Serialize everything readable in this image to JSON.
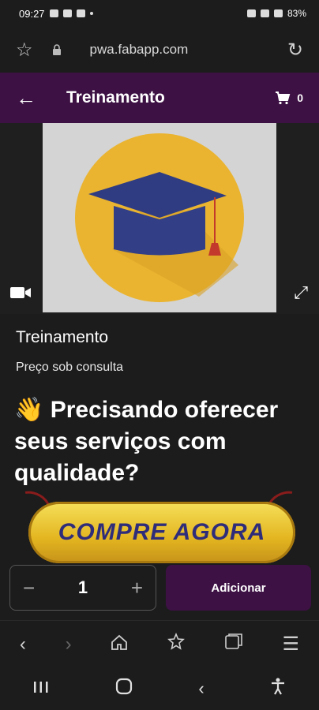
{
  "status": {
    "time": "09:27",
    "battery": "83%"
  },
  "browser": {
    "url": "pwa.fabapp.com"
  },
  "header": {
    "title": "Treinamento",
    "cart_count": "0"
  },
  "product": {
    "name": "Treinamento",
    "price": "Preço sob consulta",
    "headline_emoji": "👋",
    "headline": "Precisando oferecer seus serviços com qualidade?",
    "cta": "COMPRE AGORA"
  },
  "cart": {
    "quantity": "1",
    "add_label": "Adicionar",
    "minus": "−",
    "plus": "+"
  },
  "colors": {
    "brand": "#3d1144",
    "cta_gold": "#e3b520",
    "cta_text": "#2f2d7a"
  }
}
